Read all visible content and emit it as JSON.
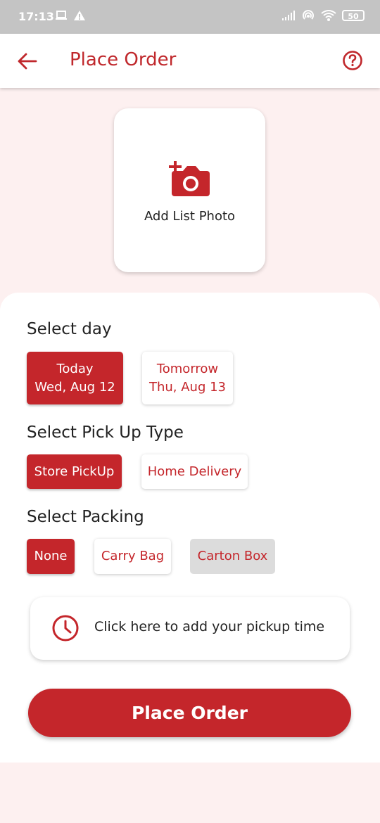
{
  "status_bar": {
    "time": "17:13",
    "battery": "50",
    "icons": [
      "laptop-icon",
      "warning-icon",
      "signal-icon",
      "hotspot-icon",
      "wifi-icon",
      "battery-icon"
    ]
  },
  "header": {
    "title": "Place Order",
    "back_icon": "arrow-left-icon",
    "help_icon": "question-circle-icon"
  },
  "photo": {
    "label": "Add List Photo",
    "icon": "add-camera-icon"
  },
  "select_day": {
    "title": "Select day",
    "options": [
      {
        "line1": "Today",
        "line2": "Wed, Aug 12",
        "selected": true
      },
      {
        "line1": "Tomorrow",
        "line2": "Thu, Aug 13",
        "selected": false
      }
    ]
  },
  "pickup_type": {
    "title": "Select Pick Up Type",
    "options": [
      {
        "label": "Store PickUp",
        "selected": true
      },
      {
        "label": "Home Delivery",
        "selected": false
      }
    ]
  },
  "packing": {
    "title": "Select Packing",
    "options": [
      {
        "label": "None",
        "selected": true
      },
      {
        "label": "Carry Bag",
        "selected": false
      },
      {
        "label": "Carton Box",
        "selected": false,
        "disabled": true
      }
    ]
  },
  "pickup_time": {
    "text": "Click here to add your pickup time",
    "icon": "clock-icon"
  },
  "submit": {
    "label": "Place Order"
  },
  "colors": {
    "accent": "#c4262b",
    "background": "#fdf0f0",
    "status_bar": "#c4c4c4"
  }
}
